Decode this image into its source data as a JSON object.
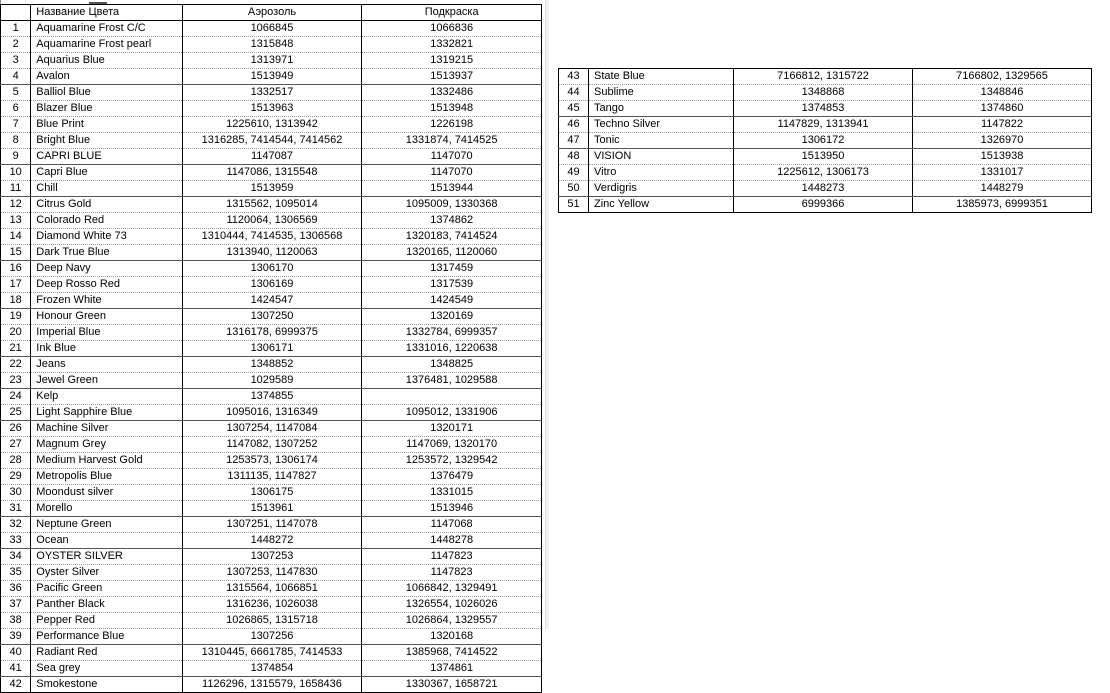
{
  "app": {
    "type": "spreadsheet-table",
    "background_color": "#ffffff",
    "text_color": "#000000",
    "grid_line_color": "#9a9a9a"
  },
  "left_table": {
    "headers": {
      "row_number": "",
      "name": "Название Цвета",
      "aerosol": "Аэрозоль",
      "touchup": "Подкраска"
    },
    "rows": [
      {
        "n": "1",
        "name": "Aquamarine Frost C/C",
        "aerosol": "1066845",
        "touchup": "1066836"
      },
      {
        "n": "2",
        "name": "Aquamarine Frost pearl",
        "aerosol": "1315848",
        "touchup": "1332821"
      },
      {
        "n": "3",
        "name": "Aquarius Blue",
        "aerosol": "1313971",
        "touchup": "1319215"
      },
      {
        "n": "4",
        "name": "Avalon",
        "aerosol": "1513949",
        "touchup": "1513937"
      },
      {
        "n": "5",
        "name": "Balliol  Blue",
        "aerosol": "1332517",
        "touchup": "1332486"
      },
      {
        "n": "6",
        "name": "Blazer Blue",
        "aerosol": "1513963",
        "touchup": "1513948"
      },
      {
        "n": "7",
        "name": "Blue Print",
        "aerosol": "1225610, 1313942",
        "touchup": "1226198"
      },
      {
        "n": "8",
        "name": "Bright Blue",
        "aerosol": "1316285, 7414544, 7414562",
        "touchup": "1331874, 7414525"
      },
      {
        "n": "9",
        "name": "CAPRI BLUE",
        "aerosol": "1147087",
        "touchup": "1147070"
      },
      {
        "n": "10",
        "name": "Capri Blue",
        "aerosol": "1147086, 1315548",
        "touchup": "1147070"
      },
      {
        "n": "11",
        "name": "Chill",
        "aerosol": "1513959",
        "touchup": "1513944"
      },
      {
        "n": "12",
        "name": "Citrus Gold",
        "aerosol": "1315562, 1095014",
        "touchup": "1095009, 1330368"
      },
      {
        "n": "13",
        "name": "Colorado Red",
        "aerosol": "1120064, 1306569",
        "touchup": "1374862"
      },
      {
        "n": "14",
        "name": "Diamond White 73",
        "aerosol": "1310444, 7414535, 1306568",
        "touchup": "1320183, 7414524"
      },
      {
        "n": "15",
        "name": "Dark True Blue",
        "aerosol": "1313940, 1120063",
        "touchup": "1320165, 1120060"
      },
      {
        "n": "16",
        "name": "Deep Navy",
        "aerosol": "1306170",
        "touchup": "1317459"
      },
      {
        "n": "17",
        "name": "Deep Rosso Red",
        "aerosol": "1306169",
        "touchup": "1317539"
      },
      {
        "n": "18",
        "name": "Frozen White",
        "aerosol": "1424547",
        "touchup": "1424549"
      },
      {
        "n": "19",
        "name": "Honour  Green",
        "aerosol": "1307250",
        "touchup": "1320169"
      },
      {
        "n": "20",
        "name": "Imperial Blue",
        "aerosol": "1316178, 6999375",
        "touchup": "1332784, 6999357"
      },
      {
        "n": "21",
        "name": "Ink Blue",
        "aerosol": "1306171",
        "touchup": "1331016, 1220638"
      },
      {
        "n": "22",
        "name": "Jeans",
        "aerosol": "1348852",
        "touchup": "1348825"
      },
      {
        "n": "23",
        "name": "Jewel Green",
        "aerosol": "1029589",
        "touchup": "1376481, 1029588"
      },
      {
        "n": "24",
        "name": "Kelp",
        "aerosol": "1374855",
        "touchup": ""
      },
      {
        "n": "25",
        "name": "Light Sapphire Blue",
        "aerosol": "1095016, 1316349",
        "touchup": "1095012, 1331906"
      },
      {
        "n": "26",
        "name": "Machine Silver",
        "aerosol": "1307254, 1147084",
        "touchup": "1320171"
      },
      {
        "n": "27",
        "name": "Magnum Grey",
        "aerosol": "1147082, 1307252",
        "touchup": "1147069, 1320170"
      },
      {
        "n": "28",
        "name": "Medium Harvest Gold",
        "aerosol": "1253573, 1306174",
        "touchup": "1253572, 1329542"
      },
      {
        "n": "29",
        "name": "Metropolis Blue",
        "aerosol": "1311135, 1147827",
        "touchup": "1376479"
      },
      {
        "n": "30",
        "name": "Moondust silver",
        "aerosol": "1306175",
        "touchup": "1331015"
      },
      {
        "n": "31",
        "name": "Morello",
        "aerosol": "1513961",
        "touchup": "1513946"
      },
      {
        "n": "32",
        "name": "Neptune Green",
        "aerosol": "1307251, 1147078",
        "touchup": "1147068"
      },
      {
        "n": "33",
        "name": "Ocean",
        "aerosol": "1448272",
        "touchup": "1448278"
      },
      {
        "n": "34",
        "name": "OYSTER SILVER",
        "aerosol": "1307253",
        "touchup": "1147823"
      },
      {
        "n": "35",
        "name": "Oyster Silver",
        "aerosol": "1307253, 1147830",
        "touchup": "1147823"
      },
      {
        "n": "36",
        "name": "Pacific Green",
        "aerosol": "1315564, 1066851",
        "touchup": "1066842, 1329491"
      },
      {
        "n": "37",
        "name": "Panther Black",
        "aerosol": "1316236, 1026038",
        "touchup": "1326554, 1026026"
      },
      {
        "n": "38",
        "name": "Pepper Red",
        "aerosol": "1026865, 1315718",
        "touchup": "1026864, 1329557"
      },
      {
        "n": "39",
        "name": "Performance Blue",
        "aerosol": "1307256",
        "touchup": "1320168"
      },
      {
        "n": "40",
        "name": "Radiant Red",
        "aerosol": "1310445, 6661785, 7414533",
        "touchup": "1385968, 7414522"
      },
      {
        "n": "41",
        "name": "Sea grey",
        "aerosol": "1374854",
        "touchup": "1374861"
      },
      {
        "n": "42",
        "name": "Smokestone",
        "aerosol": "1126296, 1315579, 1658436",
        "touchup": "1330367, 1658721"
      }
    ]
  },
  "right_table": {
    "rows": [
      {
        "n": "43",
        "name": "State Blue",
        "aerosol": "7166812, 1315722",
        "touchup": "7166802, 1329565"
      },
      {
        "n": "44",
        "name": "Sublime",
        "aerosol": "1348868",
        "touchup": "1348846"
      },
      {
        "n": "45",
        "name": "Tango",
        "aerosol": "1374853",
        "touchup": "1374860"
      },
      {
        "n": "46",
        "name": "Techno Silver",
        "aerosol": "1147829, 1313941",
        "touchup": "1147822"
      },
      {
        "n": "47",
        "name": "Tonic",
        "aerosol": "1306172",
        "touchup": "1326970"
      },
      {
        "n": "48",
        "name": "VISION",
        "aerosol": "1513950",
        "touchup": "1513938"
      },
      {
        "n": "49",
        "name": "Vitro",
        "aerosol": "1225612, 1306173",
        "touchup": "1331017"
      },
      {
        "n": "50",
        "name": "Verdigris",
        "aerosol": "1448273",
        "touchup": "1448279"
      },
      {
        "n": "51",
        "name": "Zinc Yellow",
        "aerosol": "6999366",
        "touchup": "1385973, 6999351"
      }
    ]
  }
}
